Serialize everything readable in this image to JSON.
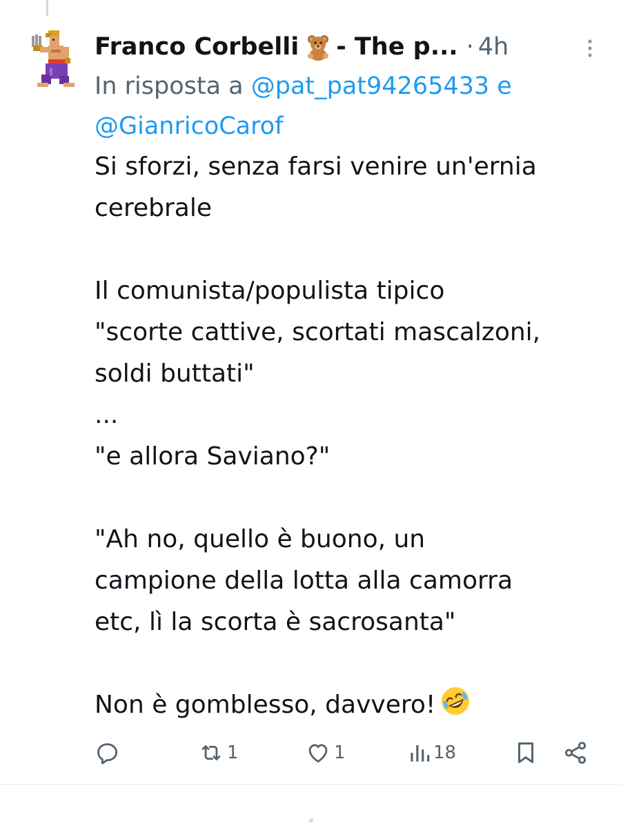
{
  "tweet": {
    "author_name": "Franco Corbelli",
    "author_suffix": "- The p...",
    "separator": "·",
    "time": "4h",
    "reply_prefix": "In risposta a",
    "reply_mention_1": "@pat_pat94265433",
    "reply_conjunction": "e",
    "reply_mention_2": "@GianricoCarof",
    "text_lines": [
      "Si sforzi, senza farsi venire un'ernia",
      "cerebrale",
      "",
      "Il comunista/populista tipico",
      "\"scorte cattive, scortati mascalzoni,",
      "soldi buttati\"",
      "...",
      "\"e allora Saviano?\"",
      "",
      "\"Ah no, quello è buono, un",
      "campione della lotta alla camorra",
      "etc, lì la scorta è sacrosanta\"",
      "",
      "Non è gomblesso, davvero!"
    ],
    "final_emoji": "rolling-on-floor-laughing-emoji"
  },
  "actions": {
    "reply": {
      "icon": "reply-icon",
      "count": ""
    },
    "retweet": {
      "icon": "retweet-icon",
      "count": "1"
    },
    "like": {
      "icon": "heart-icon",
      "count": "1"
    },
    "views": {
      "icon": "views-icon",
      "count": "18"
    },
    "bookmark": {
      "icon": "bookmark-icon"
    },
    "share": {
      "icon": "share-icon"
    }
  },
  "colors": {
    "text": "#0f1419",
    "secondary": "#536471",
    "link": "#1d9bf0",
    "divider": "#e6ecf0"
  }
}
